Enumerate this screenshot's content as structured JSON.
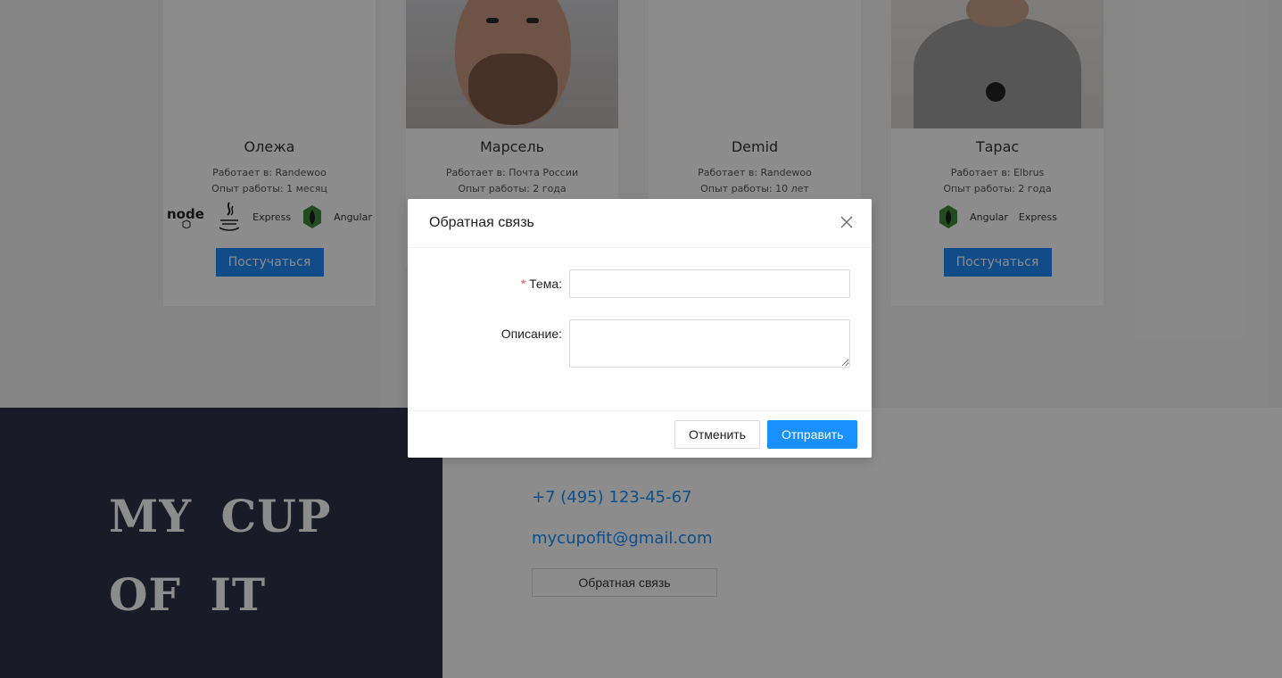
{
  "mentors": [
    {
      "name": "Олежа",
      "work": "Работает в: Randewoo",
      "experience": "Опыт работы: 1 месяц",
      "tech": [
        "node-icon",
        "java-icon",
        "Express",
        "mongo-icon",
        "Angular"
      ],
      "button": "Постучаться"
    },
    {
      "name": "Марсель",
      "work": "Работает в: Почта России",
      "experience": "Опыт работы: 2 года"
    },
    {
      "name": "Demid",
      "work": "Работает в: Randewoo",
      "experience": "Опыт работы: 10 лет"
    },
    {
      "name": "Тарас",
      "work": "Работает в: Elbrus",
      "experience": "Опыт работы: 2 года",
      "tech": [
        "mongo-icon",
        "Angular",
        "Express"
      ],
      "button": "Постучаться"
    }
  ],
  "tech_labels": {
    "express": "Express",
    "angular": "Angular",
    "node": "node"
  },
  "footer": {
    "brand_line1": "MY CUP",
    "brand_line2": "OF IT",
    "phone": "+7 (495) 123-45-67",
    "email": "mycupofit@gmail.com",
    "feedback_button": "Обратная связь"
  },
  "modal": {
    "title": "Обратная связь",
    "subject_label": "Тема",
    "required_mark": "*",
    "description_label": "Описание",
    "colon": ":",
    "cancel": "Отменить",
    "submit": "Отправить"
  },
  "colors": {
    "primary": "#1890ff",
    "button_card": "#1f89f7",
    "footer_dark": "#30324a",
    "required": "#ff4d4f"
  }
}
